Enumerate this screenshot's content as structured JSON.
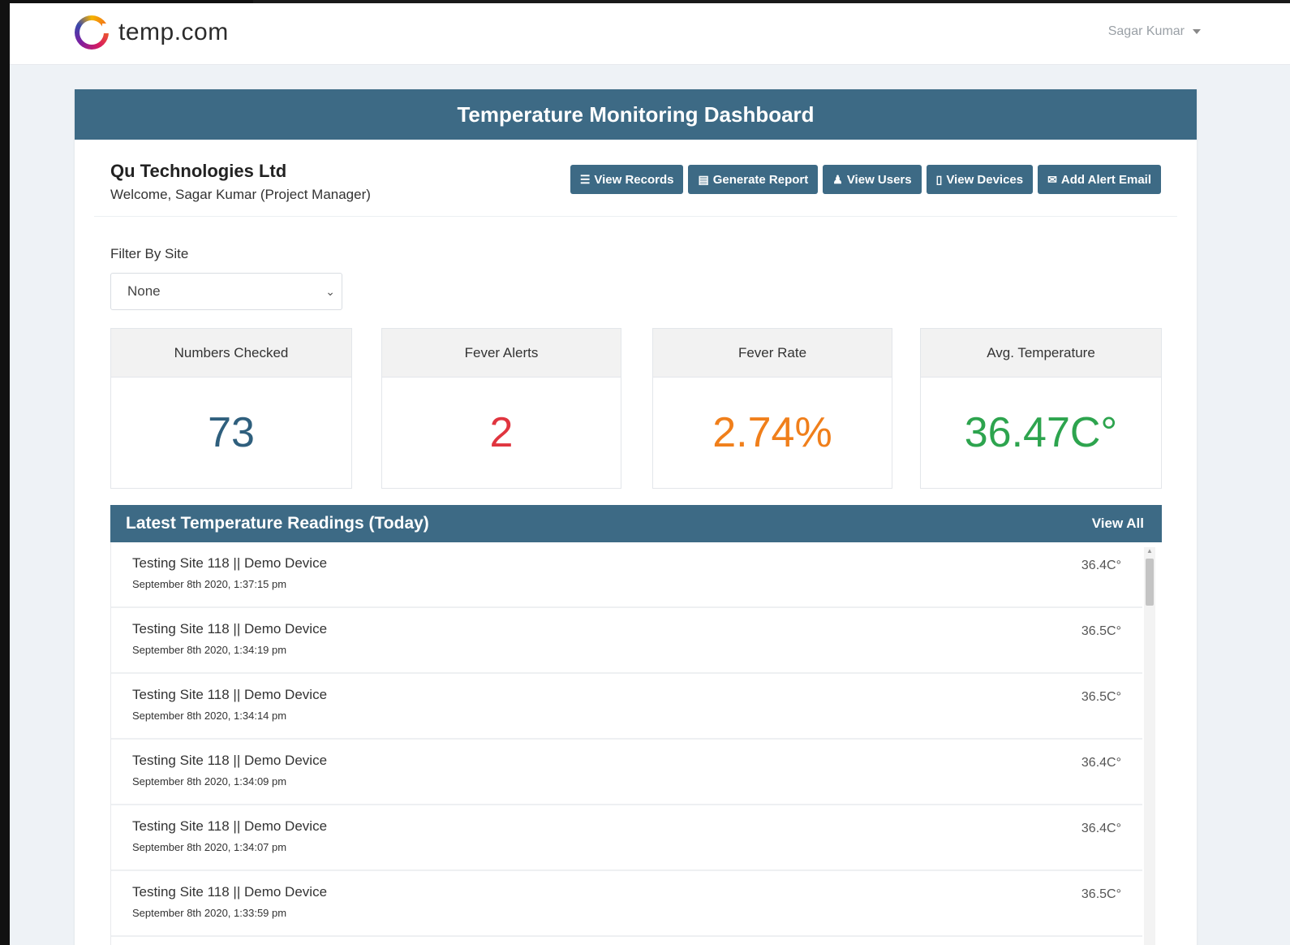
{
  "brand": {
    "name": "temp.com"
  },
  "user": {
    "name": "Sagar Kumar"
  },
  "dashboard": {
    "title": "Temperature Monitoring Dashboard"
  },
  "company": {
    "name": "Qu Technologies Ltd",
    "welcome": "Welcome, Sagar Kumar (Project Manager)"
  },
  "actions": [
    {
      "label": "View Records",
      "icon": "list-icon"
    },
    {
      "label": "Generate Report",
      "icon": "document-icon"
    },
    {
      "label": "View Users",
      "icon": "user-icon"
    },
    {
      "label": "View Devices",
      "icon": "device-icon"
    },
    {
      "label": "Add Alert Email",
      "icon": "envelope-icon"
    }
  ],
  "filter": {
    "label": "Filter By Site",
    "selected": "None"
  },
  "stats": [
    {
      "label": "Numbers Checked",
      "value": "73",
      "color": "#2f5f7d"
    },
    {
      "label": "Fever Alerts",
      "value": "2",
      "color": "#e0353f"
    },
    {
      "label": "Fever Rate",
      "value": "2.74%",
      "color": "#f07f1b"
    },
    {
      "label": "Avg. Temperature",
      "value": "36.47C°",
      "color": "#2da44e"
    }
  ],
  "readings": {
    "title": "Latest Temperature Readings (Today)",
    "view_all": "View All",
    "rows": [
      {
        "title": "Testing Site 118 || Demo Device",
        "time": "September 8th 2020, 1:37:15 pm",
        "temp": "36.4C°"
      },
      {
        "title": "Testing Site 118 || Demo Device",
        "time": "September 8th 2020, 1:34:19 pm",
        "temp": "36.5C°"
      },
      {
        "title": "Testing Site 118 || Demo Device",
        "time": "September 8th 2020, 1:34:14 pm",
        "temp": "36.5C°"
      },
      {
        "title": "Testing Site 118 || Demo Device",
        "time": "September 8th 2020, 1:34:09 pm",
        "temp": "36.4C°"
      },
      {
        "title": "Testing Site 118 || Demo Device",
        "time": "September 8th 2020, 1:34:07 pm",
        "temp": "36.4C°"
      },
      {
        "title": "Testing Site 118 || Demo Device",
        "time": "September 8th 2020, 1:33:59 pm",
        "temp": "36.5C°"
      }
    ]
  }
}
